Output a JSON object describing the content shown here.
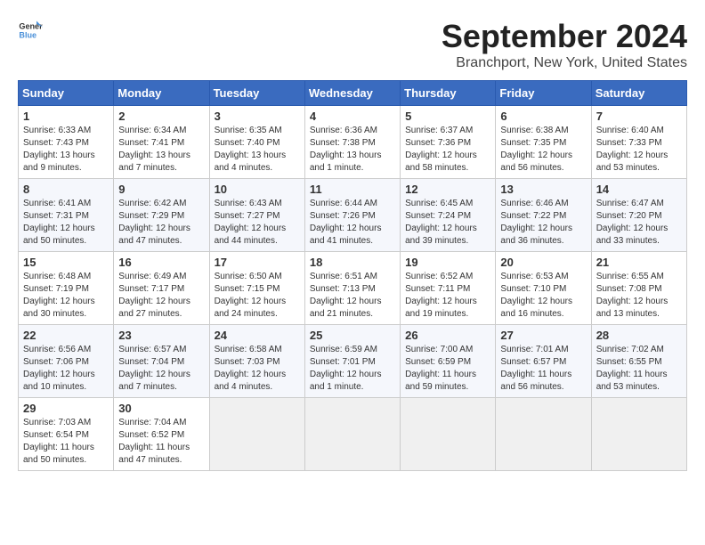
{
  "header": {
    "logo_general": "General",
    "logo_blue": "Blue",
    "month_title": "September 2024",
    "location": "Branchport, New York, United States"
  },
  "calendar": {
    "days_of_week": [
      "Sunday",
      "Monday",
      "Tuesday",
      "Wednesday",
      "Thursday",
      "Friday",
      "Saturday"
    ],
    "weeks": [
      [
        {
          "day": "1",
          "sunrise": "6:33 AM",
          "sunset": "7:43 PM",
          "daylight": "13 hours and 9 minutes."
        },
        {
          "day": "2",
          "sunrise": "6:34 AM",
          "sunset": "7:41 PM",
          "daylight": "13 hours and 7 minutes."
        },
        {
          "day": "3",
          "sunrise": "6:35 AM",
          "sunset": "7:40 PM",
          "daylight": "13 hours and 4 minutes."
        },
        {
          "day": "4",
          "sunrise": "6:36 AM",
          "sunset": "7:38 PM",
          "daylight": "13 hours and 1 minute."
        },
        {
          "day": "5",
          "sunrise": "6:37 AM",
          "sunset": "7:36 PM",
          "daylight": "12 hours and 58 minutes."
        },
        {
          "day": "6",
          "sunrise": "6:38 AM",
          "sunset": "7:35 PM",
          "daylight": "12 hours and 56 minutes."
        },
        {
          "day": "7",
          "sunrise": "6:40 AM",
          "sunset": "7:33 PM",
          "daylight": "12 hours and 53 minutes."
        }
      ],
      [
        {
          "day": "8",
          "sunrise": "6:41 AM",
          "sunset": "7:31 PM",
          "daylight": "12 hours and 50 minutes."
        },
        {
          "day": "9",
          "sunrise": "6:42 AM",
          "sunset": "7:29 PM",
          "daylight": "12 hours and 47 minutes."
        },
        {
          "day": "10",
          "sunrise": "6:43 AM",
          "sunset": "7:27 PM",
          "daylight": "12 hours and 44 minutes."
        },
        {
          "day": "11",
          "sunrise": "6:44 AM",
          "sunset": "7:26 PM",
          "daylight": "12 hours and 41 minutes."
        },
        {
          "day": "12",
          "sunrise": "6:45 AM",
          "sunset": "7:24 PM",
          "daylight": "12 hours and 39 minutes."
        },
        {
          "day": "13",
          "sunrise": "6:46 AM",
          "sunset": "7:22 PM",
          "daylight": "12 hours and 36 minutes."
        },
        {
          "day": "14",
          "sunrise": "6:47 AM",
          "sunset": "7:20 PM",
          "daylight": "12 hours and 33 minutes."
        }
      ],
      [
        {
          "day": "15",
          "sunrise": "6:48 AM",
          "sunset": "7:19 PM",
          "daylight": "12 hours and 30 minutes."
        },
        {
          "day": "16",
          "sunrise": "6:49 AM",
          "sunset": "7:17 PM",
          "daylight": "12 hours and 27 minutes."
        },
        {
          "day": "17",
          "sunrise": "6:50 AM",
          "sunset": "7:15 PM",
          "daylight": "12 hours and 24 minutes."
        },
        {
          "day": "18",
          "sunrise": "6:51 AM",
          "sunset": "7:13 PM",
          "daylight": "12 hours and 21 minutes."
        },
        {
          "day": "19",
          "sunrise": "6:52 AM",
          "sunset": "7:11 PM",
          "daylight": "12 hours and 19 minutes."
        },
        {
          "day": "20",
          "sunrise": "6:53 AM",
          "sunset": "7:10 PM",
          "daylight": "12 hours and 16 minutes."
        },
        {
          "day": "21",
          "sunrise": "6:55 AM",
          "sunset": "7:08 PM",
          "daylight": "12 hours and 13 minutes."
        }
      ],
      [
        {
          "day": "22",
          "sunrise": "6:56 AM",
          "sunset": "7:06 PM",
          "daylight": "12 hours and 10 minutes."
        },
        {
          "day": "23",
          "sunrise": "6:57 AM",
          "sunset": "7:04 PM",
          "daylight": "12 hours and 7 minutes."
        },
        {
          "day": "24",
          "sunrise": "6:58 AM",
          "sunset": "7:03 PM",
          "daylight": "12 hours and 4 minutes."
        },
        {
          "day": "25",
          "sunrise": "6:59 AM",
          "sunset": "7:01 PM",
          "daylight": "12 hours and 1 minute."
        },
        {
          "day": "26",
          "sunrise": "7:00 AM",
          "sunset": "6:59 PM",
          "daylight": "11 hours and 59 minutes."
        },
        {
          "day": "27",
          "sunrise": "7:01 AM",
          "sunset": "6:57 PM",
          "daylight": "11 hours and 56 minutes."
        },
        {
          "day": "28",
          "sunrise": "7:02 AM",
          "sunset": "6:55 PM",
          "daylight": "11 hours and 53 minutes."
        }
      ],
      [
        {
          "day": "29",
          "sunrise": "7:03 AM",
          "sunset": "6:54 PM",
          "daylight": "11 hours and 50 minutes."
        },
        {
          "day": "30",
          "sunrise": "7:04 AM",
          "sunset": "6:52 PM",
          "daylight": "11 hours and 47 minutes."
        },
        null,
        null,
        null,
        null,
        null
      ]
    ]
  },
  "labels": {
    "sunrise_prefix": "Sunrise: ",
    "sunset_prefix": "Sunset: ",
    "daylight_prefix": "Daylight: "
  }
}
